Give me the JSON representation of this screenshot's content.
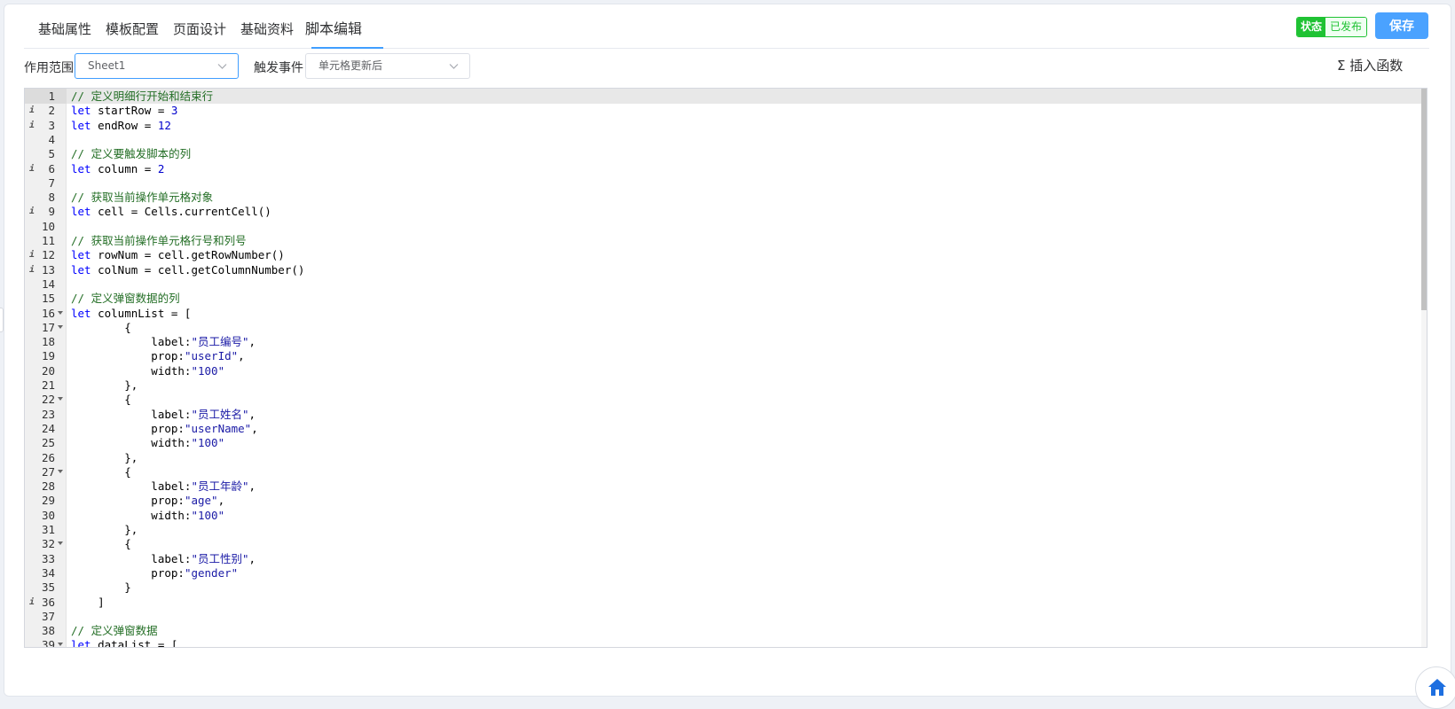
{
  "tabs": [
    {
      "label": "基础属性",
      "active": false
    },
    {
      "label": "模板配置",
      "active": false
    },
    {
      "label": "页面设计",
      "active": false
    },
    {
      "label": "基础资料",
      "active": false
    },
    {
      "label": "脚本编辑",
      "active": true
    }
  ],
  "status": {
    "key": "状态",
    "value": "已发布"
  },
  "save_label": "保存",
  "toolbar": {
    "scope_label": "作用范围",
    "scope_value": "Sheet1",
    "event_label": "触发事件",
    "event_value": "单元格更新后",
    "insert_function_label": "插入函数",
    "insert_function_icon": "sigma-icon"
  },
  "colors": {
    "accent": "#409eff",
    "published": "#1fc233"
  },
  "editor": {
    "lines": [
      {
        "n": "1",
        "mark": "",
        "fold": false,
        "tokens": [
          {
            "t": "cm",
            "v": "// 定义明细行开始和结束行"
          }
        ]
      },
      {
        "n": "2",
        "mark": "i",
        "fold": false,
        "tokens": [
          {
            "t": "kw",
            "v": "let"
          },
          {
            "t": "",
            "v": " startRow = "
          },
          {
            "t": "num",
            "v": "3"
          }
        ]
      },
      {
        "n": "3",
        "mark": "i",
        "fold": false,
        "tokens": [
          {
            "t": "kw",
            "v": "let"
          },
          {
            "t": "",
            "v": " endRow = "
          },
          {
            "t": "num",
            "v": "12"
          }
        ]
      },
      {
        "n": "4",
        "mark": "",
        "fold": false,
        "tokens": []
      },
      {
        "n": "5",
        "mark": "",
        "fold": false,
        "tokens": [
          {
            "t": "cm",
            "v": "// 定义要触发脚本的列"
          }
        ]
      },
      {
        "n": "6",
        "mark": "i",
        "fold": false,
        "tokens": [
          {
            "t": "kw",
            "v": "let"
          },
          {
            "t": "",
            "v": " column = "
          },
          {
            "t": "num",
            "v": "2"
          }
        ]
      },
      {
        "n": "7",
        "mark": "",
        "fold": false,
        "tokens": []
      },
      {
        "n": "8",
        "mark": "",
        "fold": false,
        "tokens": [
          {
            "t": "cm",
            "v": "// 获取当前操作单元格对象"
          }
        ]
      },
      {
        "n": "9",
        "mark": "i",
        "fold": false,
        "tokens": [
          {
            "t": "kw",
            "v": "let"
          },
          {
            "t": "",
            "v": " cell = Cells.currentCell()"
          }
        ]
      },
      {
        "n": "10",
        "mark": "",
        "fold": false,
        "tokens": []
      },
      {
        "n": "11",
        "mark": "",
        "fold": false,
        "tokens": [
          {
            "t": "cm",
            "v": "// 获取当前操作单元格行号和列号"
          }
        ]
      },
      {
        "n": "12",
        "mark": "i",
        "fold": false,
        "tokens": [
          {
            "t": "kw",
            "v": "let"
          },
          {
            "t": "",
            "v": " rowNum = cell.getRowNumber()"
          }
        ]
      },
      {
        "n": "13",
        "mark": "i",
        "fold": false,
        "tokens": [
          {
            "t": "kw",
            "v": "let"
          },
          {
            "t": "",
            "v": " colNum = cell.getColumnNumber()"
          }
        ]
      },
      {
        "n": "14",
        "mark": "",
        "fold": false,
        "tokens": []
      },
      {
        "n": "15",
        "mark": "",
        "fold": false,
        "tokens": [
          {
            "t": "cm",
            "v": "// 定义弹窗数据的列"
          }
        ]
      },
      {
        "n": "16",
        "mark": "",
        "fold": true,
        "tokens": [
          {
            "t": "kw",
            "v": "let"
          },
          {
            "t": "",
            "v": " columnList = ["
          }
        ]
      },
      {
        "n": "17",
        "mark": "",
        "fold": true,
        "tokens": [
          {
            "t": "",
            "v": "        {"
          }
        ]
      },
      {
        "n": "18",
        "mark": "",
        "fold": false,
        "tokens": [
          {
            "t": "",
            "v": "            label:"
          },
          {
            "t": "str",
            "v": "\"员工编号\""
          },
          {
            "t": "",
            "v": ","
          }
        ]
      },
      {
        "n": "19",
        "mark": "",
        "fold": false,
        "tokens": [
          {
            "t": "",
            "v": "            prop:"
          },
          {
            "t": "str",
            "v": "\"userId\""
          },
          {
            "t": "",
            "v": ","
          }
        ]
      },
      {
        "n": "20",
        "mark": "",
        "fold": false,
        "tokens": [
          {
            "t": "",
            "v": "            width:"
          },
          {
            "t": "str",
            "v": "\"100\""
          }
        ]
      },
      {
        "n": "21",
        "mark": "",
        "fold": false,
        "tokens": [
          {
            "t": "",
            "v": "        },"
          }
        ]
      },
      {
        "n": "22",
        "mark": "",
        "fold": true,
        "tokens": [
          {
            "t": "",
            "v": "        {"
          }
        ]
      },
      {
        "n": "23",
        "mark": "",
        "fold": false,
        "tokens": [
          {
            "t": "",
            "v": "            label:"
          },
          {
            "t": "str",
            "v": "\"员工姓名\""
          },
          {
            "t": "",
            "v": ","
          }
        ]
      },
      {
        "n": "24",
        "mark": "",
        "fold": false,
        "tokens": [
          {
            "t": "",
            "v": "            prop:"
          },
          {
            "t": "str",
            "v": "\"userName\""
          },
          {
            "t": "",
            "v": ","
          }
        ]
      },
      {
        "n": "25",
        "mark": "",
        "fold": false,
        "tokens": [
          {
            "t": "",
            "v": "            width:"
          },
          {
            "t": "str",
            "v": "\"100\""
          }
        ]
      },
      {
        "n": "26",
        "mark": "",
        "fold": false,
        "tokens": [
          {
            "t": "",
            "v": "        },"
          }
        ]
      },
      {
        "n": "27",
        "mark": "",
        "fold": true,
        "tokens": [
          {
            "t": "",
            "v": "        {"
          }
        ]
      },
      {
        "n": "28",
        "mark": "",
        "fold": false,
        "tokens": [
          {
            "t": "",
            "v": "            label:"
          },
          {
            "t": "str",
            "v": "\"员工年龄\""
          },
          {
            "t": "",
            "v": ","
          }
        ]
      },
      {
        "n": "29",
        "mark": "",
        "fold": false,
        "tokens": [
          {
            "t": "",
            "v": "            prop:"
          },
          {
            "t": "str",
            "v": "\"age\""
          },
          {
            "t": "",
            "v": ","
          }
        ]
      },
      {
        "n": "30",
        "mark": "",
        "fold": false,
        "tokens": [
          {
            "t": "",
            "v": "            width:"
          },
          {
            "t": "str",
            "v": "\"100\""
          }
        ]
      },
      {
        "n": "31",
        "mark": "",
        "fold": false,
        "tokens": [
          {
            "t": "",
            "v": "        },"
          }
        ]
      },
      {
        "n": "32",
        "mark": "",
        "fold": true,
        "tokens": [
          {
            "t": "",
            "v": "        {"
          }
        ]
      },
      {
        "n": "33",
        "mark": "",
        "fold": false,
        "tokens": [
          {
            "t": "",
            "v": "            label:"
          },
          {
            "t": "str",
            "v": "\"员工性别\""
          },
          {
            "t": "",
            "v": ","
          }
        ]
      },
      {
        "n": "34",
        "mark": "",
        "fold": false,
        "tokens": [
          {
            "t": "",
            "v": "            prop:"
          },
          {
            "t": "str",
            "v": "\"gender\""
          }
        ]
      },
      {
        "n": "35",
        "mark": "",
        "fold": false,
        "tokens": [
          {
            "t": "",
            "v": "        }"
          }
        ]
      },
      {
        "n": "36",
        "mark": "i",
        "fold": false,
        "tokens": [
          {
            "t": "",
            "v": "    ]"
          }
        ]
      },
      {
        "n": "37",
        "mark": "",
        "fold": false,
        "tokens": []
      },
      {
        "n": "38",
        "mark": "",
        "fold": false,
        "tokens": [
          {
            "t": "cm",
            "v": "// 定义弹窗数据"
          }
        ]
      },
      {
        "n": "39",
        "mark": "",
        "fold": true,
        "tokens": [
          {
            "t": "kw",
            "v": "let"
          },
          {
            "t": "",
            "v": " dataList = ["
          }
        ]
      }
    ]
  }
}
